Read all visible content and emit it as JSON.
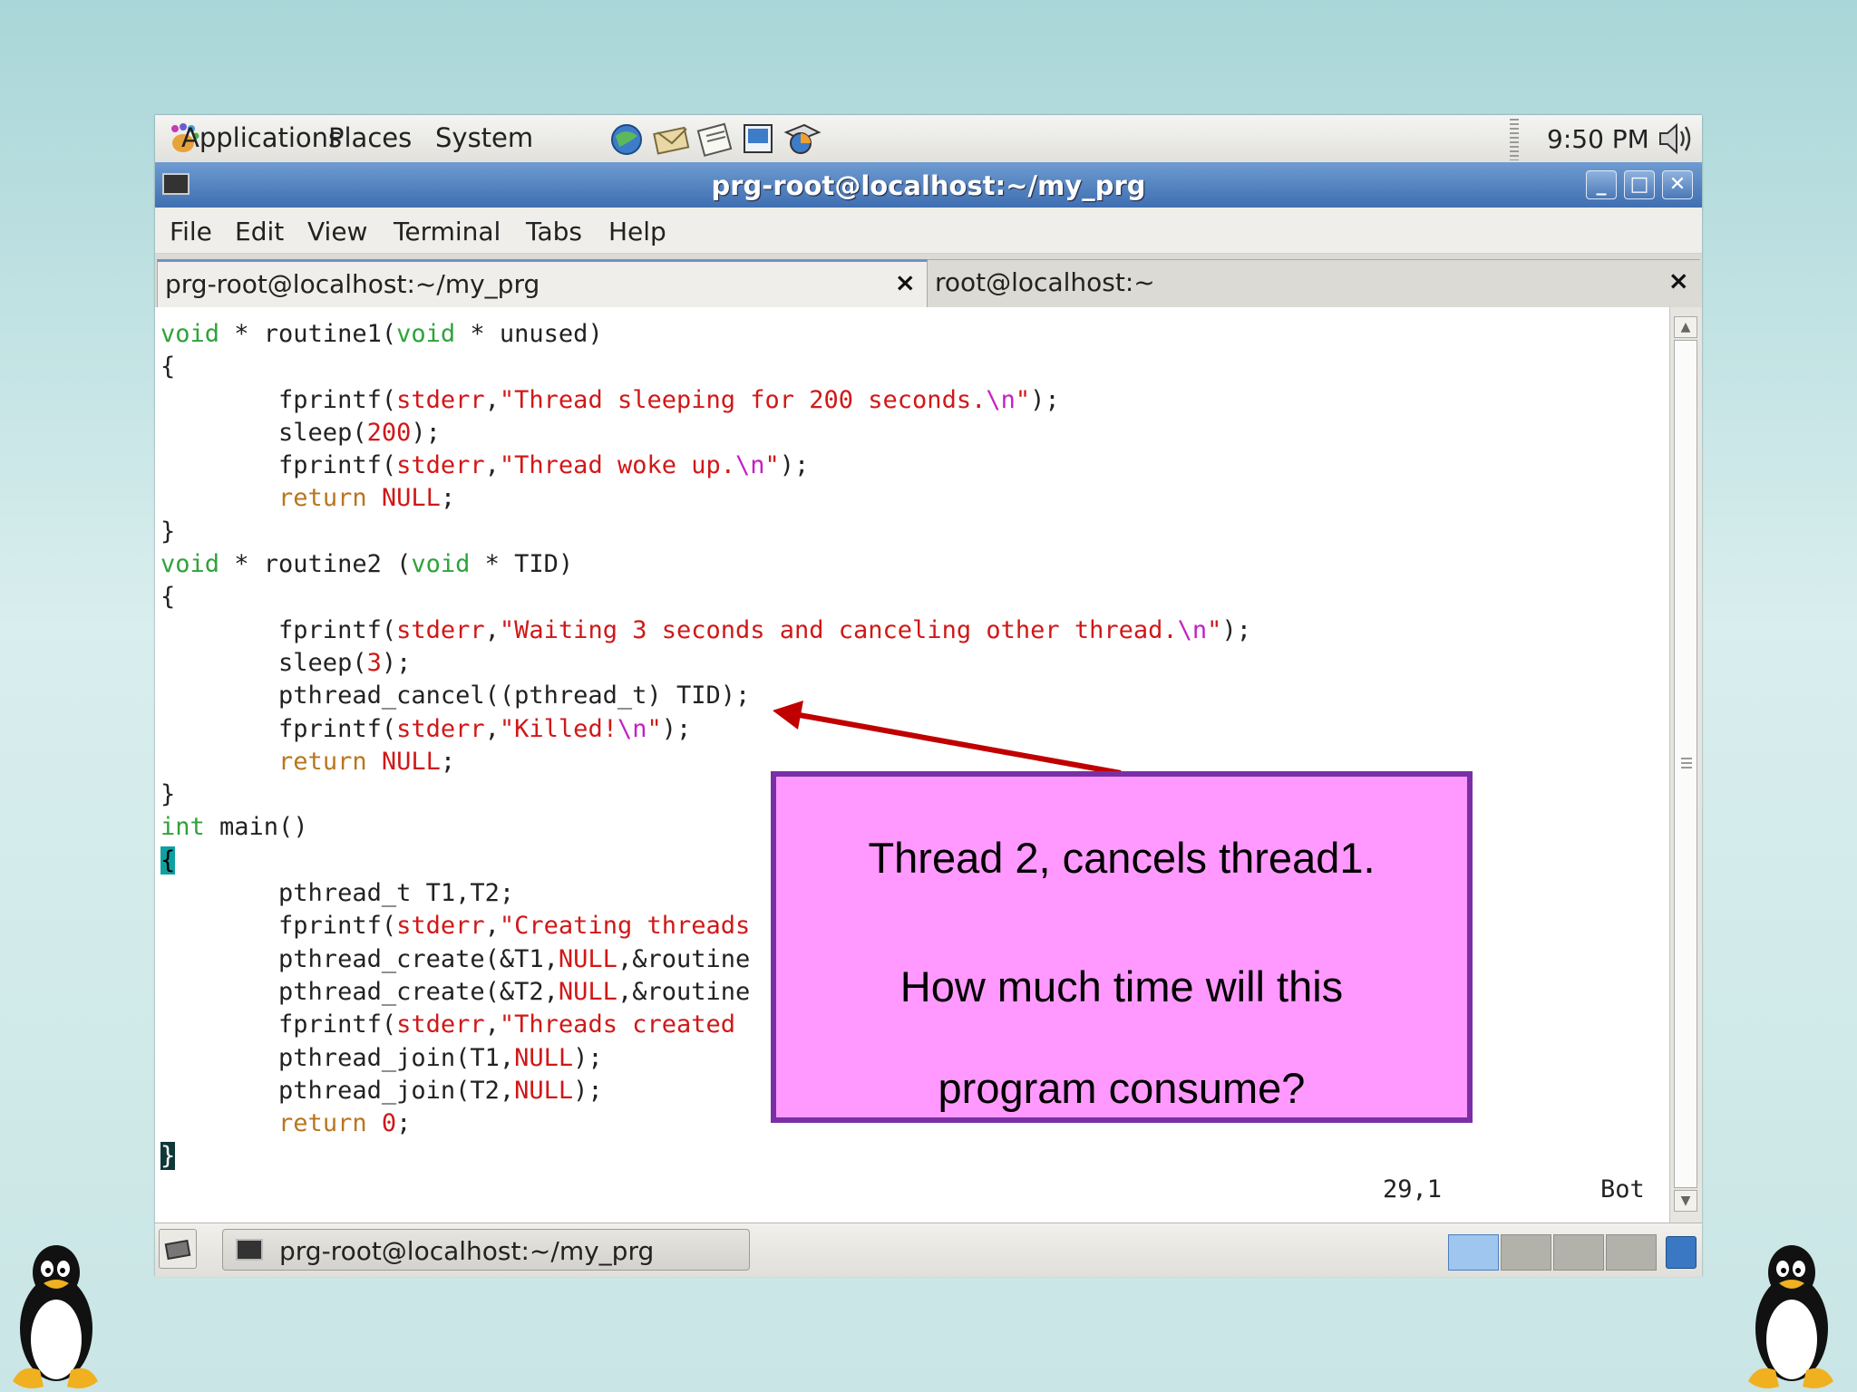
{
  "top_panel": {
    "menus": [
      "Applications",
      "Places",
      "System"
    ],
    "launcher_icons": [
      "web-browser-icon",
      "mail-icon",
      "notes-icon",
      "presentation-icon",
      "chart-icon"
    ],
    "clock": "9:50 PM",
    "volume_icon": "volume-icon"
  },
  "window": {
    "title": "prg-root@localhost:~/my_prg",
    "controls": {
      "minimize": "_",
      "maximize": "□",
      "close": "✕"
    }
  },
  "menubar": [
    "File",
    "Edit",
    "View",
    "Terminal",
    "Tabs",
    "Help"
  ],
  "tabs": [
    {
      "label": "prg-root@localhost:~/my_prg",
      "close": "×",
      "active": true
    },
    {
      "label": "root@localhost:~",
      "close": "×",
      "active": false
    }
  ],
  "terminal": {
    "lines": [
      "void * routine1(void * unused)",
      "{",
      "        fprintf(stderr,\"Thread sleeping for 200 seconds.\\n\");",
      "        sleep(200);",
      "        fprintf(stderr,\"Thread woke up.\\n\");",
      "        return NULL;",
      "}",
      "void * routine2 (void * TID)",
      "{",
      "        fprintf(stderr,\"Waiting 3 seconds and canceling other thread.\\n\");",
      "        sleep(3);",
      "        pthread_cancel((pthread_t) TID);",
      "        fprintf(stderr,\"Killed!\\n\");",
      "        return NULL;",
      "}",
      "int main()",
      "{",
      "        pthread_t T1,T2;",
      "        fprintf(stderr,\"Creating threads",
      "        pthread_create(&T1,NULL,&routine",
      "        pthread_create(&T2,NULL,&routine",
      "        fprintf(stderr,\"Threads created",
      "        pthread_join(T1,NULL);",
      "        pthread_join(T2,NULL);",
      "        return 0;",
      "}"
    ],
    "status_position": "29,1",
    "status_scroll": "Bot"
  },
  "bottom_panel": {
    "task_label": "prg-root@localhost:~/my_prg",
    "workspaces": 4,
    "active_workspace": 1
  },
  "callout": {
    "line1": "Thread 2, cancels thread1.",
    "line2": "How much time will this",
    "line3": "program consume?"
  },
  "colors": {
    "callout_fill": "#ff99ff",
    "callout_border": "#7a2fa6",
    "arrow": "#c00000",
    "titlebar": "#4f7fbf"
  }
}
